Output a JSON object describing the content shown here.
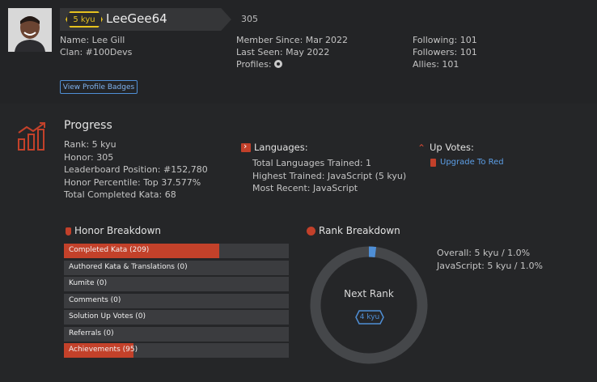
{
  "profile": {
    "rank_badge": "5 kyu",
    "username": "LeeGee64",
    "honor": "305",
    "name": "Name: Lee Gill",
    "clan": "Clan: #100Devs",
    "member_since": "Member Since: Mar 2022",
    "last_seen": "Last Seen: May 2022",
    "profiles_label": "Profiles:",
    "profiles_icon": "github-icon",
    "following": "Following: 101",
    "followers": "Followers: 101",
    "allies": "Allies: 101",
    "badges_button": "View Profile Badges"
  },
  "progress": {
    "title": "Progress",
    "rank": "Rank: 5 kyu",
    "honor": "Honor: 305",
    "leaderboard": "Leaderboard Position: #152,780",
    "percentile": "Honor Percentile: Top 37.577%",
    "completed": "Total Completed Kata: 68"
  },
  "languages": {
    "title": "Languages:",
    "trained": "Total Languages Trained: 1",
    "highest": "Highest Trained: JavaScript (5 kyu)",
    "recent": "Most Recent: JavaScript"
  },
  "upvotes": {
    "title": "Up Votes:",
    "link": "Upgrade To Red"
  },
  "honor_breakdown": {
    "title": "Honor Breakdown",
    "rows": [
      {
        "label": "Completed Kata (209)",
        "fill": 0.69
      },
      {
        "label": "Authored Kata & Translations (0)",
        "fill": 0
      },
      {
        "label": "Kumite (0)",
        "fill": 0
      },
      {
        "label": "Comments (0)",
        "fill": 0
      },
      {
        "label": "Solution Up Votes (0)",
        "fill": 0
      },
      {
        "label": "Referrals (0)",
        "fill": 0
      },
      {
        "label": "Achievements (95)",
        "fill": 0.31
      }
    ]
  },
  "rank_breakdown": {
    "title": "Rank Breakdown",
    "next_rank_label": "Next Rank",
    "next_rank_badge": "4 kyu",
    "progress_fraction": 0.02,
    "overall": "Overall: 5 kyu / 1.0%",
    "javascript": "JavaScript: 5 kyu / 1.0%"
  },
  "colors": {
    "accent_red": "#c3412a",
    "kyu_yellow": "#e6c21f",
    "link_blue": "#5c9ee6"
  }
}
